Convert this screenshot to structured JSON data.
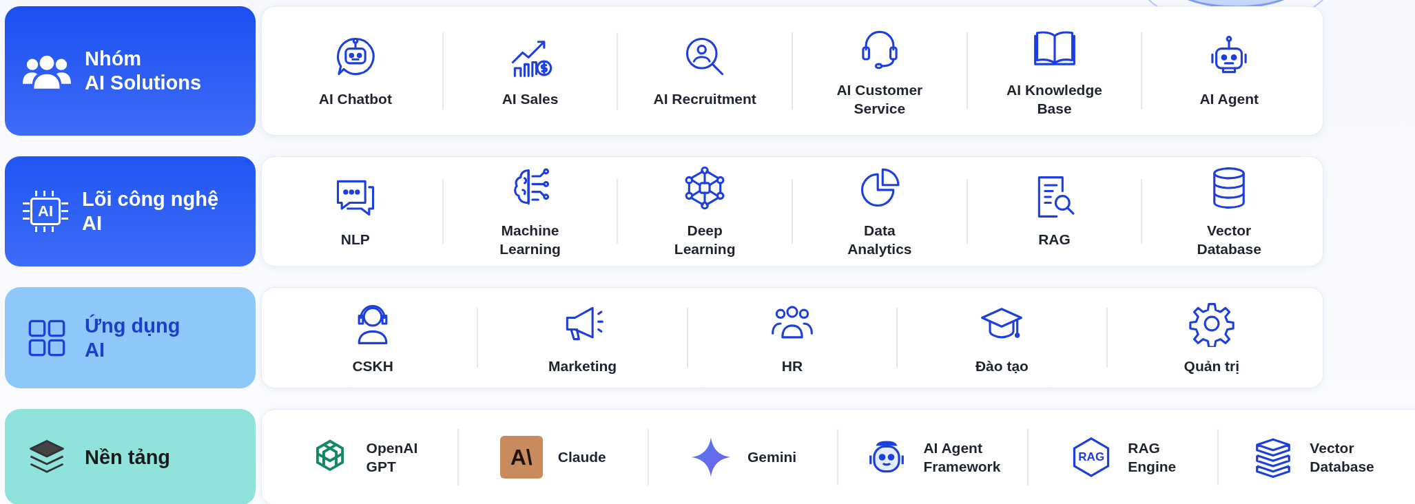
{
  "groups": [
    {
      "title": "Nhóm\nAI Solutions",
      "kind": "solid",
      "color": "#1a4ff0",
      "items": [
        {
          "label": "AI Chatbot",
          "kind": "stacked"
        },
        {
          "label": "AI Sales",
          "kind": "stacked"
        },
        {
          "label": "AI Recruitment",
          "kind": "stacked"
        },
        {
          "label": "AI Customer\nService",
          "kind": "stacked"
        },
        {
          "label": "AI Knowledge\nBase",
          "kind": "stacked"
        },
        {
          "label": "AI Agent",
          "kind": "stacked"
        }
      ]
    },
    {
      "title": "Lõi công nghệ\nAI",
      "kind": "solid",
      "color": "#1f55f2",
      "icon_text": "AI",
      "items": [
        {
          "label": "NLP",
          "kind": "stacked"
        },
        {
          "label": "Machine\nLearning",
          "kind": "stacked"
        },
        {
          "label": "Deep\nLearning",
          "kind": "stacked"
        },
        {
          "label": "Data\nAnalytics",
          "kind": "stacked"
        },
        {
          "label": "RAG",
          "kind": "stacked"
        },
        {
          "label": "Vector\nDatabase",
          "kind": "stacked"
        }
      ]
    },
    {
      "title": "Ứng dụng\nAI",
      "kind": "soft",
      "color": "#8ec8fb",
      "items": [
        {
          "label": "CSKH",
          "kind": "stacked"
        },
        {
          "label": "Marketing",
          "kind": "stacked"
        },
        {
          "label": "HR",
          "kind": "stacked"
        },
        {
          "label": "Đào tạo",
          "kind": "stacked"
        },
        {
          "label": "Quản trị",
          "kind": "stacked"
        }
      ]
    },
    {
      "title": "Nền tảng",
      "kind": "mint",
      "color": "#8fe3da",
      "items": [
        {
          "label": "OpenAI\nGPT",
          "kind": "inline"
        },
        {
          "label": "Claude",
          "kind": "inline",
          "icon_text": "A\\"
        },
        {
          "label": "Gemini",
          "kind": "inline"
        },
        {
          "label": "AI Agent\nFramework",
          "kind": "inline"
        },
        {
          "label": "RAG\nEngine",
          "kind": "inline",
          "icon_text": "RAG"
        },
        {
          "label": "Vector\nDatabase",
          "kind": "inline"
        }
      ]
    }
  ]
}
